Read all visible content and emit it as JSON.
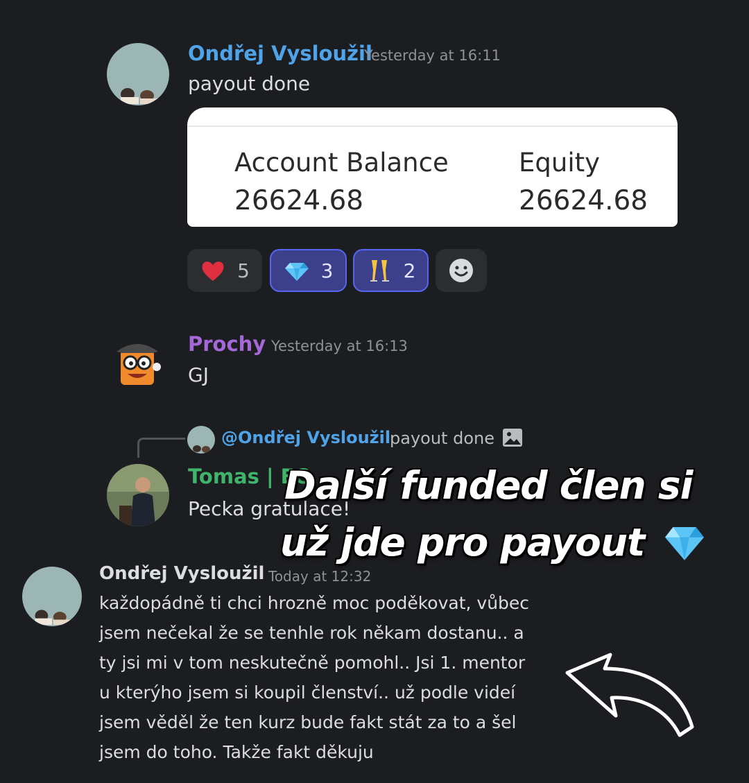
{
  "messages": [
    {
      "author": "Ondřej Vysloužil",
      "author_color": "#4fa3e8",
      "timestamp": "Yesterday at 16:11",
      "text": "payout done",
      "embed": {
        "balance_label": "Account Balance",
        "balance_value": "26624.68",
        "equity_label": "Equity",
        "equity_value": "26624.68"
      },
      "reactions": [
        {
          "emoji": "heart-emoji",
          "count": "5",
          "active": false
        },
        {
          "emoji": "gem-emoji",
          "count": "3",
          "active": true
        },
        {
          "emoji": "champagne-emoji",
          "count": "2",
          "active": true
        }
      ]
    },
    {
      "author": "Prochy",
      "author_color": "#a568d8",
      "timestamp": "Yesterday at 16:13",
      "text": "GJ"
    },
    {
      "reply_to": {
        "mention": "@Ondřej Vysloužil",
        "preview": "payout done"
      },
      "author": "Tomas | EC",
      "author_color": "#3fb56a",
      "text": "Pecka gratulace!"
    },
    {
      "author": "Ondřej Vysloužil",
      "author_color": "#dcddde",
      "timestamp": "Today at 12:32",
      "lines": [
        "každopádně ti chci hrozně moc poděkovat, vůbec",
        "jsem nečekal že se tenhle rok někam dostanu.. a",
        "ty jsi mi v tom neskutečně pomohl.. Jsi 1. mentor",
        "u kterýho jsem si koupil členství.. už podle videí",
        "jsem věděl že ten kurz bude fakt stát za to a šel",
        "jsem do toho. Takže fakt děkuju"
      ]
    }
  ],
  "overlay": {
    "line1": "Další funded člen si",
    "line2": "už jde pro payout"
  },
  "colors": {
    "background": "#1c1d21",
    "reaction_active_bg": "#3c3f8a",
    "reaction_active_border": "#5865f2",
    "mention": "#4fa3e8"
  }
}
